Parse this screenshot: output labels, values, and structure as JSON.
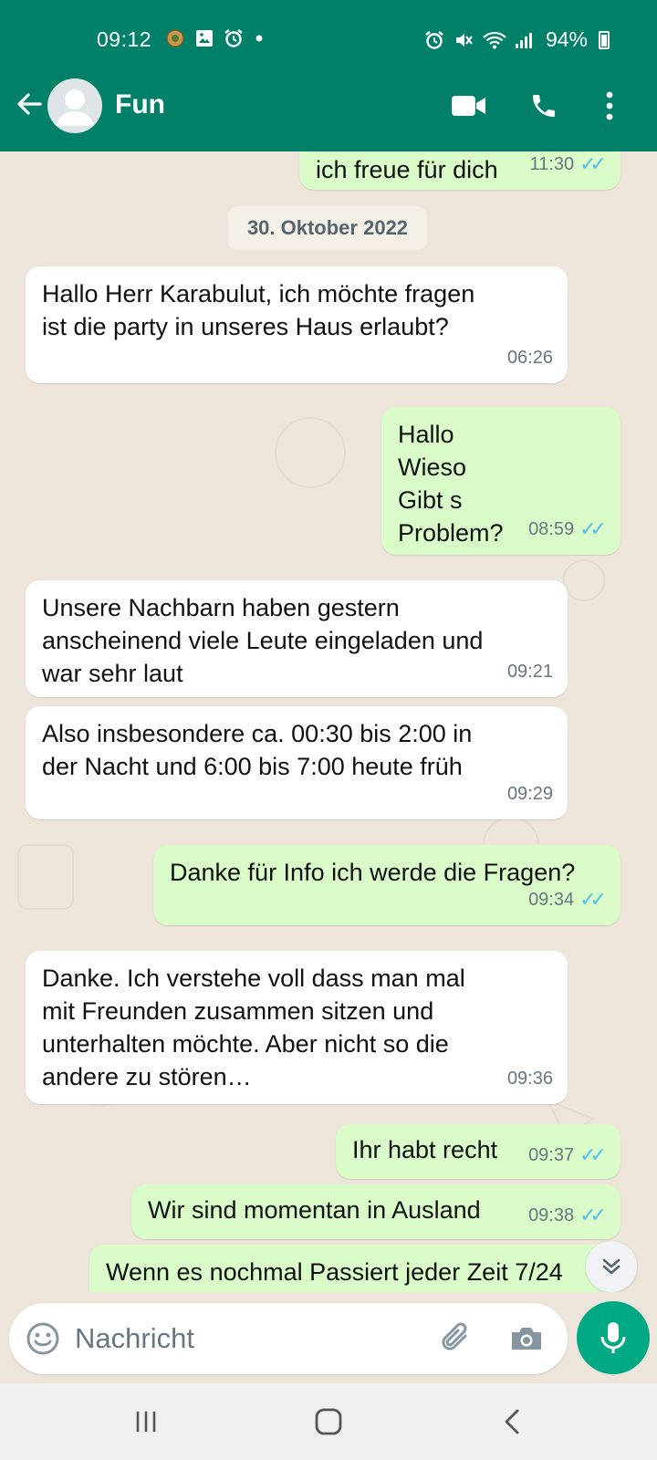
{
  "status_bar": {
    "time": "09:12",
    "battery": "94%"
  },
  "header": {
    "chat_name": "Fun"
  },
  "date_separator": "30. Oktober 2022",
  "messages": [
    {
      "dir": "out",
      "text": "ich freue für dich",
      "time": "11:30",
      "read": true
    },
    {
      "dir": "in",
      "text": "Hallo Herr Karabulut, ich möchte fragen\nist die party in unseres Haus erlaubt?",
      "time": "06:26"
    },
    {
      "dir": "out",
      "text": "Hallo\nWieso\nGibt s\nProblem?",
      "time": "08:59",
      "read": true
    },
    {
      "dir": "in",
      "text": "Unsere Nachbarn haben gestern\nanscheinend viele Leute eingeladen und\nwar sehr laut",
      "time": "09:21"
    },
    {
      "dir": "in",
      "text": "Also insbesondere ca. 00:30 bis 2:00 in\nder Nacht und 6:00 bis 7:00 heute früh",
      "time": "09:29"
    },
    {
      "dir": "out",
      "text": "Danke für Info  ich werde die Fragen?",
      "time": "09:34",
      "read": true
    },
    {
      "dir": "in",
      "text": "Danke. Ich verstehe voll dass man mal\nmit Freunden zusammen sitzen und\nunterhalten möchte. Aber nicht so die\nandere zu stören…",
      "time": "09:36"
    },
    {
      "dir": "out",
      "text": "Ihr habt recht",
      "time": "09:37",
      "read": true
    },
    {
      "dir": "out",
      "text": "Wir sind momentan in Ausland",
      "time": "09:38",
      "read": true
    },
    {
      "dir": "out",
      "text": "Wenn es nochmal Passiert jeder Zeit 7/24",
      "time": "",
      "read": false
    }
  ],
  "composer": {
    "placeholder": "Nachricht"
  },
  "colors": {
    "header": "#008069",
    "outgoing_bubble": "#dafcc8",
    "incoming_bubble": "#ffffff",
    "chat_background": "#ede4da",
    "read_ticks": "#53bdeb",
    "mic_button": "#00a884"
  },
  "icons": {
    "header": [
      "back-arrow-icon",
      "avatar-icon",
      "video-call-icon",
      "phone-call-icon",
      "more-vert-icon"
    ],
    "composer": [
      "emoji-icon",
      "attach-icon",
      "camera-icon",
      "mic-icon"
    ],
    "navbar": [
      "recents-icon",
      "home-icon",
      "back-icon"
    ]
  }
}
